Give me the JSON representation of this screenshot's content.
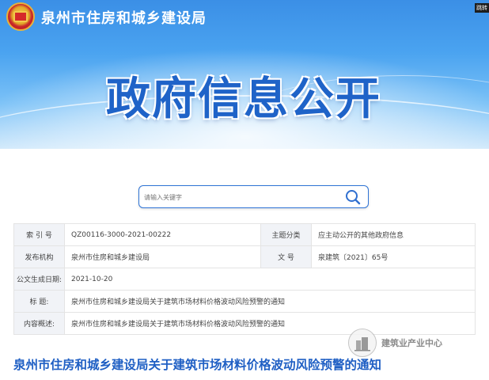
{
  "header": {
    "site_name": "泉州市住房和城乡建设局",
    "corner_label": "跳转",
    "banner_title": "政府信息公开"
  },
  "search": {
    "placeholder": "请输入关键字"
  },
  "info": {
    "index_label": "索 引 号",
    "index_value": "QZ00116-3000-2021-00222",
    "category_label": "主题分类",
    "category_value": "应主动公开的其他政府信息",
    "issuer_label": "发布机构",
    "issuer_value": "泉州市住房和城乡建设局",
    "docno_label": "文  号",
    "docno_value": "泉建筑〔2021〕65号",
    "date_label": "公文生成日期:",
    "date_value": "2021-10-20",
    "title_label": "标  题:",
    "title_value": "泉州市住房和城乡建设局关于建筑市场材料价格波动风险预警的通知",
    "summary_label": "内容概述:",
    "summary_value": "泉州市住房和城乡建设局关于建筑市场材料价格波动风险预警的通知"
  },
  "notice": {
    "title": "泉州市住房和城乡建设局关于建筑市场材料价格波动风险预警的通知"
  },
  "watermark": {
    "text": "建筑业产业中心"
  },
  "colors": {
    "primary_blue": "#1f5fc4",
    "banner_blue": "#3b8fe6",
    "label_bg": "#f1f3f7"
  }
}
